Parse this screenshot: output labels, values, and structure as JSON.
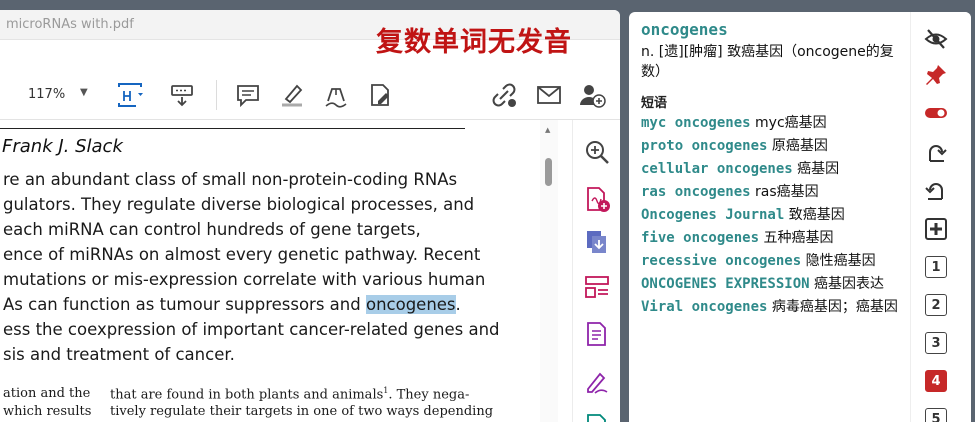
{
  "pdf": {
    "title": "microRNAs with.pdf",
    "zoom": "117%",
    "author": "Frank J. Slack",
    "abstract_lines": [
      "re an abundant class of small non-protein-coding RNAs",
      "gulators. They regulate diverse biological processes, and",
      " each miRNA can control hundreds of gene targets,",
      "ence of miRNAs on almost every genetic pathway. Recent",
      "mutations or mis-expression correlate with various human",
      "ess the coexpression of important cancer-related genes and",
      "sis and treatment of cancer."
    ],
    "highlight_line": {
      "before": "As can function as tumour suppressors and ",
      "highlight": "oncogenes",
      "after": "."
    },
    "left_column": [
      "ation and the",
      "which results"
    ],
    "right_column": [
      "that are found in both plants and animals",
      "1",
      ". They nega-",
      "tively regulate their targets in one of two ways depending"
    ]
  },
  "overlay_caption": "复数单词无发音",
  "dictionary": {
    "word": "oncogenes",
    "definition": "n. [遗][肿瘤] 致癌基因（oncogene的复数）",
    "phrases_title": "短语",
    "phrases": [
      {
        "en": "myc oncogenes",
        "cn": "myc癌基因"
      },
      {
        "en": "proto oncogenes",
        "cn": "原癌基因"
      },
      {
        "en": "cellular oncogenes",
        "cn": "癌基因"
      },
      {
        "en": "ras oncogenes",
        "cn": "ras癌基因"
      },
      {
        "en": "Oncogenes Journal",
        "cn": "致癌基因"
      },
      {
        "en": "five oncogenes",
        "cn": "五种癌基因"
      },
      {
        "en": "recessive oncogenes",
        "cn": "隐性癌基因"
      },
      {
        "en": "ONCOGENES EXPRESSION",
        "cn": "癌基因表达"
      },
      {
        "en": "Viral oncogenes",
        "cn": "病毒癌基因；癌基因"
      }
    ],
    "side_numbers": [
      "1",
      "2",
      "3",
      "4",
      "5"
    ]
  },
  "colors": {
    "accent_teal": "#2f8a8a",
    "pin_red": "#c62828",
    "highlight_blue": "#a8cde8",
    "caption_red": "#c01414",
    "acrobat_magenta": "#c2185b"
  }
}
